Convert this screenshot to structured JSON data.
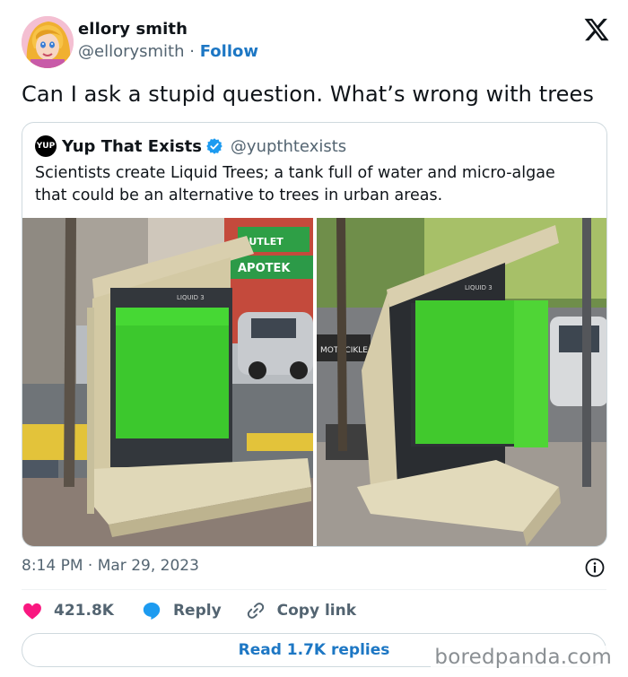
{
  "author": {
    "name": "ellory smith",
    "handle": "@ellorysmith",
    "separator": "·",
    "follow_label": "Follow"
  },
  "tweet": {
    "text": "Can I ask a stupid question. What’s wrong with trees"
  },
  "quoted": {
    "logo_text": "YUP",
    "name": "Yup That Exists",
    "handle": "@yupthtexists",
    "text": "Scientists create Liquid Trees; a tank full of water and micro-algae that could be an alternative to trees in urban areas.",
    "image_left": {
      "shop_sign_top": "OUTLET",
      "shop_sign_middle": "APOTEK",
      "tank_label": "LIQUID 3"
    },
    "image_right": {
      "sign": "MOTOCIKLE",
      "tank_label": "LIQUID 3"
    }
  },
  "meta": {
    "time": "8:14 PM",
    "separator": "·",
    "date": "Mar 29, 2023"
  },
  "actions": {
    "likes": "421.8K",
    "reply_label": "Reply",
    "copy_label": "Copy link"
  },
  "read_replies_label": "Read 1.7K replies",
  "watermark": "boredpanda.com",
  "colors": {
    "accent": "#1d77c4",
    "like": "#f91880",
    "muted": "#536471",
    "border": "#cfd9de",
    "verified": "#1d9bf0"
  }
}
